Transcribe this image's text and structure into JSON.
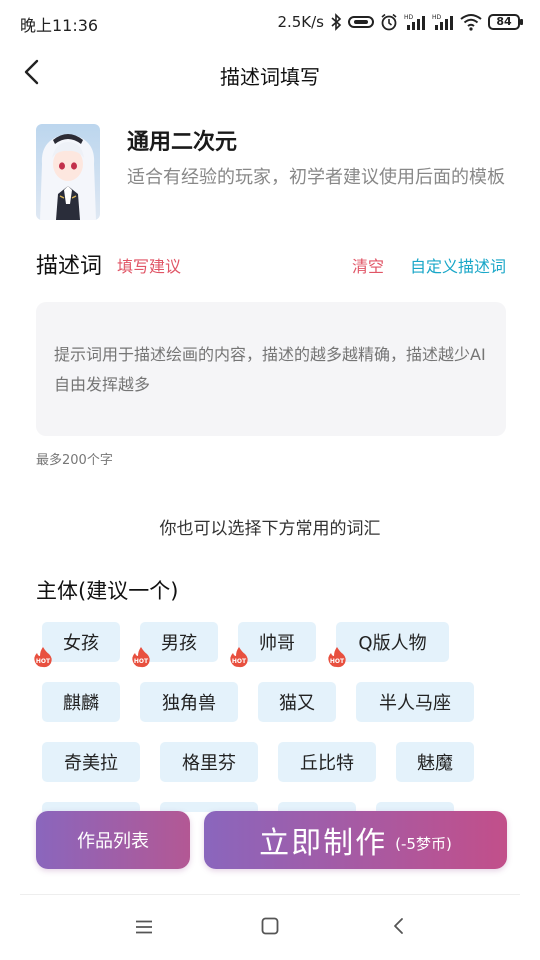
{
  "status_bar": {
    "time": "晚上11:36",
    "network_speed": "2.5K/s",
    "battery": "84",
    "icons": [
      "bluetooth-icon",
      "hd-signal-icon",
      "alarm-icon",
      "hd-signal-icon",
      "hd-signal-icon",
      "wifi-icon",
      "battery-icon"
    ]
  },
  "header": {
    "title": "描述词填写",
    "back_icon": "chevron-left-icon"
  },
  "template": {
    "name": "通用二次元",
    "description": "适合有经验的玩家，初学者建议使用后面的模板"
  },
  "prompt": {
    "label": "描述词",
    "tip_link": "填写建议",
    "clear_label": "清空",
    "custom_label": "自定义描述词",
    "placeholder": "提示词用于描述绘画的内容，描述的越多越精确，描述越少AI自由发挥越多",
    "value": "",
    "limit_note": "最多200个字"
  },
  "hint": "你也可以选择下方常用的词汇",
  "subject_section": {
    "title": "主体(建议一个)",
    "chips": [
      {
        "label": "女孩",
        "hot": true
      },
      {
        "label": "男孩",
        "hot": true
      },
      {
        "label": "帅哥",
        "hot": true
      },
      {
        "label": "Q版人物",
        "hot": true
      },
      {
        "label": "麒麟",
        "hot": false
      },
      {
        "label": "独角兽",
        "hot": false
      },
      {
        "label": "猫又",
        "hot": false
      },
      {
        "label": "半人马座",
        "hot": false
      },
      {
        "label": "奇美拉",
        "hot": false
      },
      {
        "label": "格里芬",
        "hot": false
      },
      {
        "label": "丘比特",
        "hot": false
      },
      {
        "label": "魅魔",
        "hot": false
      }
    ],
    "hot_badge_text": "HOT"
  },
  "actions": {
    "works_list": "作品列表",
    "create_now": "立即制作",
    "create_cost": "(-5梦币)"
  },
  "nav_bar": {
    "icons": [
      "menu-icon",
      "home-square-icon",
      "back-triangle-icon"
    ]
  },
  "colors": {
    "accent_red": "#e05566",
    "accent_cyan": "#1aa7c8",
    "chip_bg": "#e4f2fb",
    "button_gradient_start": "#8a66bd",
    "button_gradient_end": "#c24f8a"
  }
}
